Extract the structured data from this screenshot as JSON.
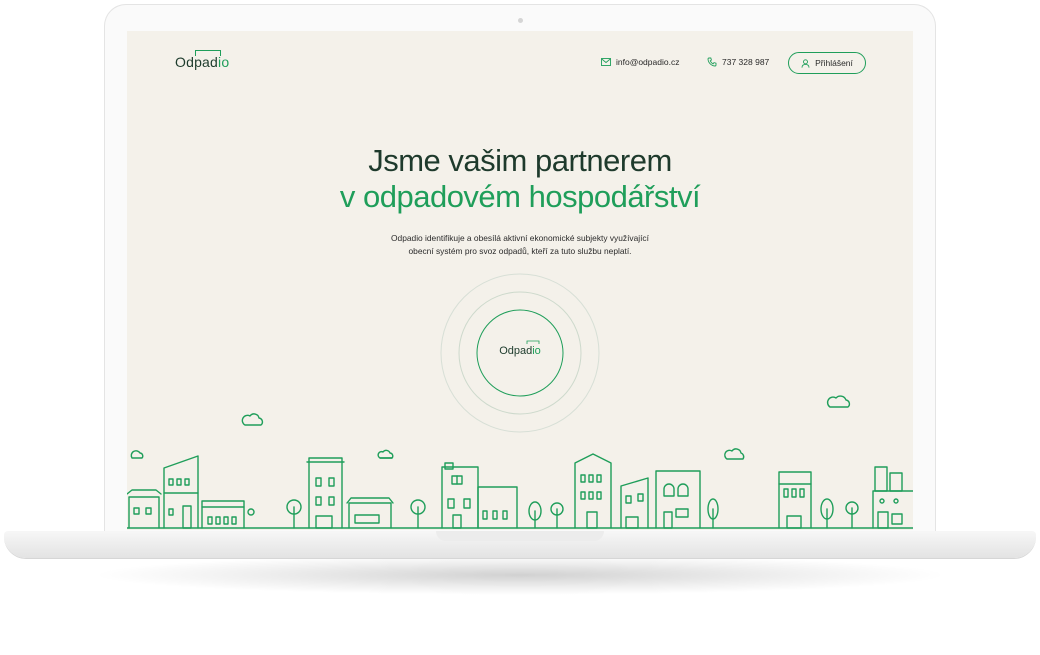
{
  "header": {
    "logo_text": "Odpad",
    "logo_accent": "io",
    "email": "info@odpadio.cz",
    "phone": "737 328 987",
    "login_label": "Přihlášení"
  },
  "hero": {
    "title_line1": "Jsme vašim partnerem",
    "title_line2": "v odpadovém hospodářství",
    "lead_line1": "Odpadio identifikuje a obesílá aktivní ekonomické subjekty využívající",
    "lead_line2": "obecní systém pro svoz odpadů, kteří za tuto službu neplatí.",
    "badge_text": "Odpad",
    "badge_accent": "io"
  },
  "theme": {
    "background": "#f4f1ea",
    "brand_green": "#1f9e5a",
    "dark_green": "#1e3a2c"
  },
  "icons": [
    "mail-icon",
    "phone-icon",
    "user-icon",
    "cloud-icon",
    "house-icon",
    "tree-icon"
  ]
}
